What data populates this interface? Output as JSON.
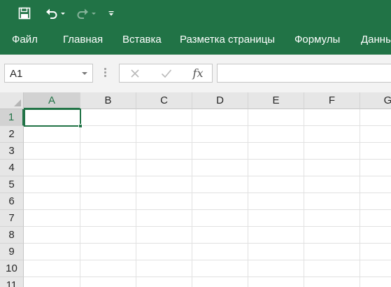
{
  "qat": {
    "save_icon": "floppy-disk-icon",
    "undo_icon": "undo-icon",
    "redo_icon": "redo-icon",
    "customize_icon": "customize-toolbar-icon"
  },
  "ribbon": {
    "tabs": [
      {
        "label": "Файл"
      },
      {
        "label": "Главная"
      },
      {
        "label": "Вставка"
      },
      {
        "label": "Разметка страницы"
      },
      {
        "label": "Формулы"
      },
      {
        "label": "Данны"
      }
    ]
  },
  "formula_bar": {
    "name_box": "A1",
    "cancel_icon": "cancel-x-icon",
    "enter_icon": "checkmark-icon",
    "fx_label": "fx",
    "formula_value": ""
  },
  "sheet": {
    "columns": [
      "A",
      "B",
      "C",
      "D",
      "E",
      "F",
      "G"
    ],
    "rows": [
      "1",
      "2",
      "3",
      "4",
      "5",
      "6",
      "7",
      "8",
      "9",
      "10",
      "11"
    ],
    "active_column": "A",
    "active_row": "1"
  },
  "colors": {
    "accent": "#217346",
    "header_bg": "#e6e6e6",
    "header_selected_bg": "#d2d2d2",
    "gridline": "#d4d4d4"
  }
}
